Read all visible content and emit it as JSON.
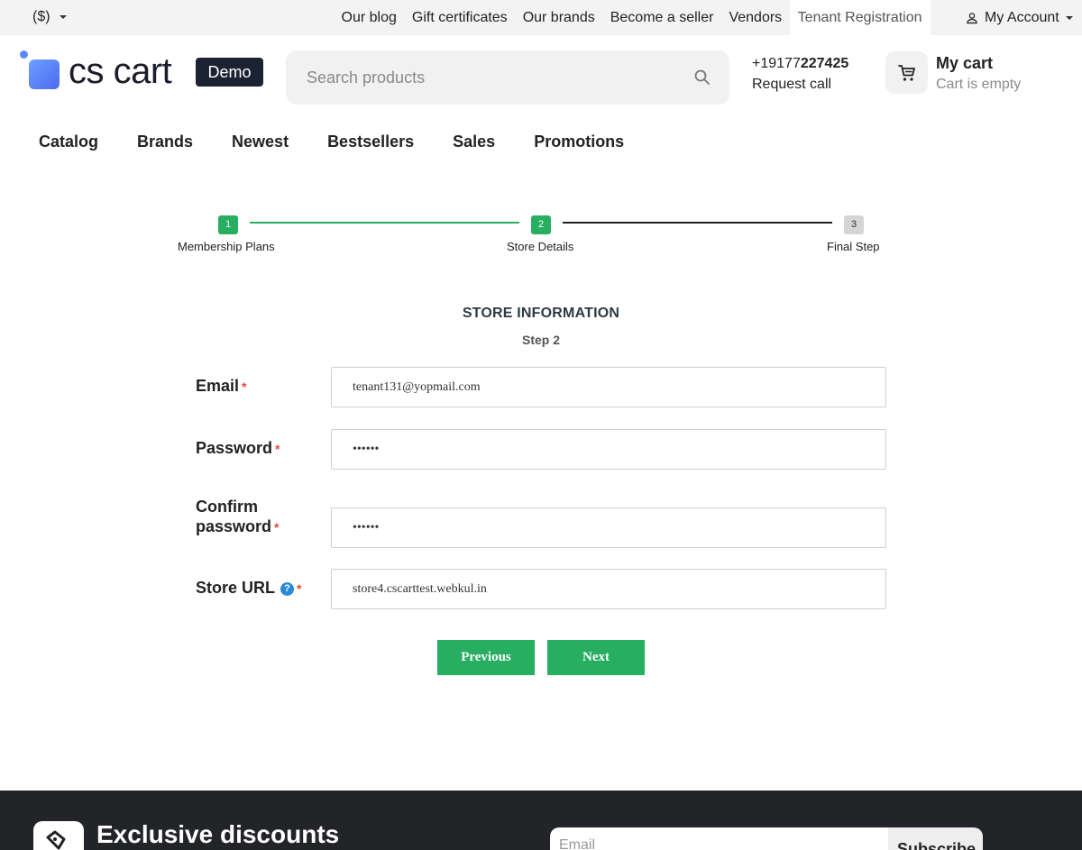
{
  "topbar": {
    "currency": "($)",
    "links": [
      {
        "label": "Our blog",
        "active": false
      },
      {
        "label": "Gift certificates",
        "active": false
      },
      {
        "label": "Our brands",
        "active": false
      },
      {
        "label": "Become a seller",
        "active": false
      },
      {
        "label": "Vendors",
        "active": false
      },
      {
        "label": "Tenant Registration",
        "active": true
      }
    ],
    "account_label": "My Account"
  },
  "header": {
    "logo_text": "cs cart",
    "badge": "Demo",
    "search_placeholder": "Search products",
    "phone_prefix": "+19177",
    "phone_bold": "227425",
    "request_call": "Request call",
    "cart_title": "My cart",
    "cart_status": "Cart is empty"
  },
  "nav": [
    "Catalog",
    "Brands",
    "Newest",
    "Bestsellers",
    "Sales",
    "Promotions"
  ],
  "stepper": {
    "steps": [
      {
        "number": "1",
        "label": "Membership Plans",
        "state": "done"
      },
      {
        "number": "2",
        "label": "Store Details",
        "state": "current"
      },
      {
        "number": "3",
        "label": "Final Step",
        "state": "pending"
      }
    ],
    "colors": {
      "done": "#27ae60",
      "pending": "#d5d5d5",
      "line_done": "#27ae60",
      "line_pending": "#1f1f1f"
    }
  },
  "form": {
    "title": "STORE INFORMATION",
    "subtitle": "Step 2",
    "email_label": "Email",
    "email_value": "tenant131@yopmail.com",
    "password_label": "Password",
    "password_value": "••••••",
    "confirm_label_1": "Confirm",
    "confirm_label_2": "password",
    "confirm_value": "••••••",
    "store_url_label": "Store URL",
    "store_url_value": "store4.cscarttest.webkul.in",
    "required_mark": "*",
    "help_glyph": "?",
    "previous_label": "Previous",
    "next_label": "Next"
  },
  "footer": {
    "title": "Exclusive discounts",
    "email_placeholder": "Email",
    "subscribe_label": "Subscribe"
  },
  "colors": {
    "accent_green": "#27ae60",
    "dark_badge": "#1b2333",
    "footer_bg": "#222427"
  }
}
